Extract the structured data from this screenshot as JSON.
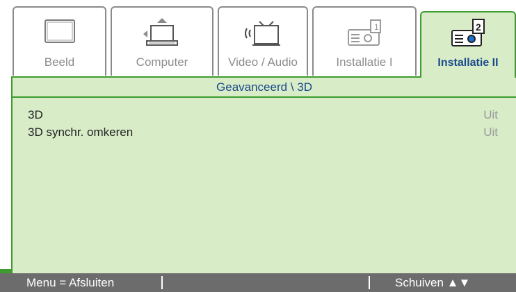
{
  "tabs": [
    {
      "label": "Beeld",
      "icon": "monitor-icon"
    },
    {
      "label": "Computer",
      "icon": "laptop-icon"
    },
    {
      "label": "Video / Audio",
      "icon": "video-audio-icon"
    },
    {
      "label": "Installatie I",
      "icon": "projector-icon"
    },
    {
      "label": "Installatie II",
      "icon": "projector-help-icon",
      "active": true
    }
  ],
  "breadcrumb": "Geavanceerd \\ 3D",
  "settings": [
    {
      "label": "3D",
      "value": "Uit"
    },
    {
      "label": "3D synchr. omkeren",
      "value": "Uit"
    }
  ],
  "footer": {
    "exit_hint": "Menu = Afsluiten",
    "navigate_hint": "Schuiven ▲▼"
  },
  "colors": {
    "accent_green": "#3d9b2f",
    "panel_bg": "#d8ecc8",
    "active_text": "#1a4a8a",
    "footer_bg": "#6c6c6c"
  }
}
